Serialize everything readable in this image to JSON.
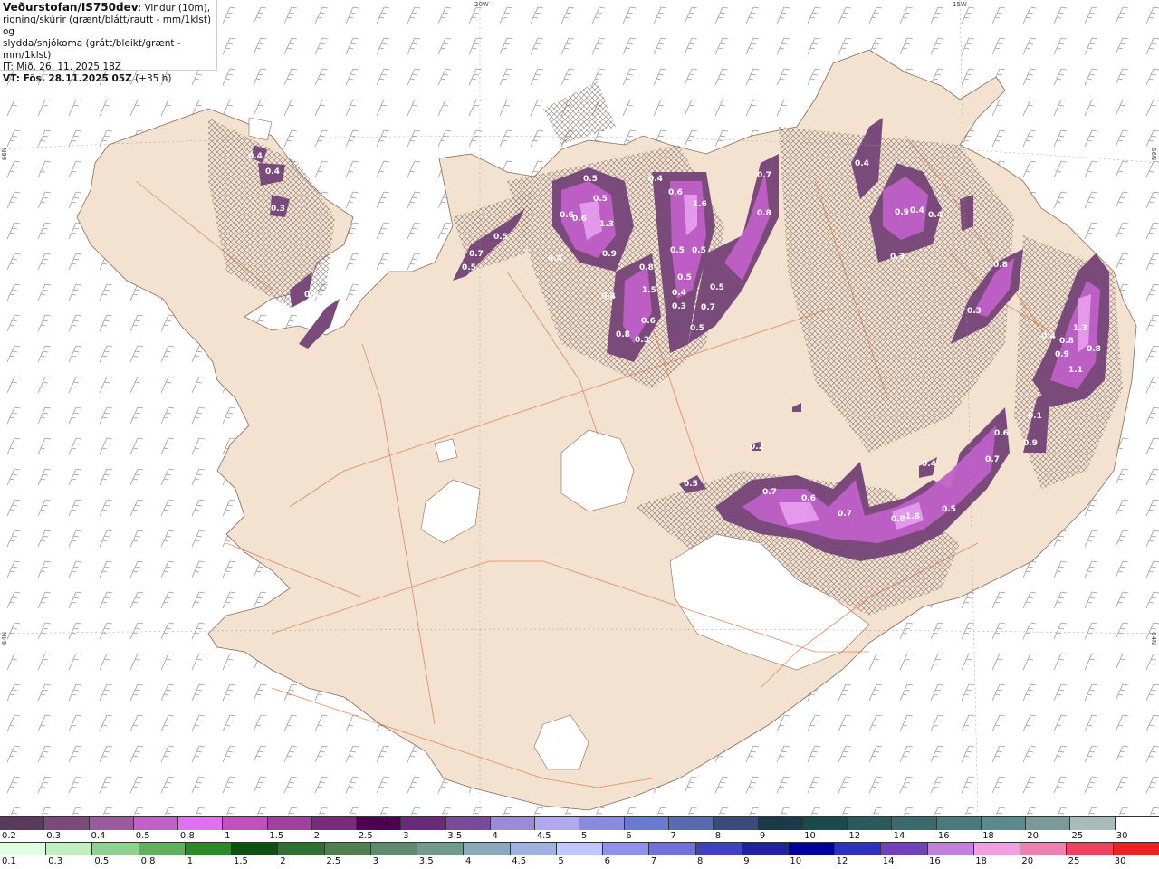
{
  "header": {
    "source": "Veðurstofan/IS750dev",
    "description_line1": ": Vindur (10m),",
    "description_line2": "rigning/skúrir (grænt/blátt/rautt - mm/1klst) og",
    "description_line3": "slydda/snjókoma (grátt/bleikt/grænt - mm/1klst)",
    "initial_time": "IT: Mið. 26. 11. 2025 18Z",
    "valid_time": "VT: Fös. 28.11.2025 05Z",
    "valid_rel": "(+35 h)"
  },
  "graticule": {
    "lon_top_1": "20W",
    "lon_top_2": "15W",
    "lat_left_1": "66N",
    "lat_left_2": "64N",
    "lat_right_1": "66N",
    "lat_right_2": "64N"
  },
  "map_labels": {
    "values": [
      "0.4",
      "0.4",
      "0.3",
      "0.5",
      "0.7",
      "0.5",
      "0.6",
      "0.5",
      "0.6",
      "0.5",
      "1.3",
      "0.9",
      "0.4",
      "0.6",
      "1.6",
      "0.7",
      "0.8",
      "0.4",
      "0.6",
      "0.5",
      "0.5",
      "0.8",
      "0.4",
      "1.5",
      "0.5",
      "0.5",
      "0.4",
      "0.3",
      "0.7",
      "0.6",
      "0.5",
      "0.8",
      "0.3",
      "0.9",
      "0.4",
      "0.4",
      "0.4",
      "0.3",
      "0.8",
      "0.3",
      "0.4",
      "0.8",
      "1.3",
      "0.9",
      "0.8",
      "1.1",
      "0.6",
      "0.5",
      "0.7",
      "0.6",
      "0.4",
      "0.7",
      "0.7",
      "0.8",
      "1.8",
      "0.9",
      "0.5",
      "0.2",
      "0.1"
    ]
  },
  "colors": {
    "land": "#f3e2d0",
    "sea": "#ffffff",
    "glacier": "#ffffff",
    "roads": "#e07040",
    "precip_light": "#7a4b7a",
    "precip_mid": "#b050b8",
    "precip_heavy": "#e070f0"
  },
  "scale_snow": {
    "labels": [
      "0.2",
      "0.3",
      "0.4",
      "0.5",
      "0.8",
      "1",
      "1.5",
      "2",
      "2.5",
      "3",
      "3.5",
      "4",
      "4.5",
      "5",
      "6",
      "7",
      "8",
      "9",
      "10",
      "12",
      "14",
      "16",
      "18",
      "20",
      "25",
      "30"
    ],
    "colors": [
      "#5a3a5a",
      "#7a4b7a",
      "#9a5a9e",
      "#c060c8",
      "#e070f0",
      "#c050c0",
      "#a040a0",
      "#7a2a7a",
      "#500050",
      "#6a2a7a",
      "#7a4a9a",
      "#9a8ad8",
      "#b0a8f0",
      "#8a8ae0",
      "#6a7ad0",
      "#5a6ab0",
      "#3a4a7a",
      "#1a3a4a",
      "#1a4a4a",
      "#2a5a5a",
      "#3a6a6a",
      "#4a7a7a",
      "#5a8a8a",
      "#7a9a9a",
      "#aabbbb",
      "#ffffff"
    ]
  },
  "scale_rain": {
    "labels": [
      "0.1",
      "0.3",
      "0.5",
      "0.8",
      "1",
      "1.5",
      "2",
      "2.5",
      "3",
      "3.5",
      "4",
      "4.5",
      "5",
      "6",
      "7",
      "8",
      "9",
      "10",
      "12",
      "14",
      "16",
      "18",
      "20",
      "25",
      "30"
    ],
    "colors": [
      "#e0ffe0",
      "#c0f0c0",
      "#90d090",
      "#60b060",
      "#2a8a2a",
      "#105010",
      "#307030",
      "#508050",
      "#608a70",
      "#709a8a",
      "#8aaabb",
      "#a0b0e0",
      "#c0c8ff",
      "#9090f0",
      "#7070e0",
      "#4040c0",
      "#2020a0",
      "#0000a0",
      "#3030c0",
      "#7040c0",
      "#c080e0",
      "#f0a0e0",
      "#f080b0",
      "#f04060",
      "#f02020"
    ]
  }
}
